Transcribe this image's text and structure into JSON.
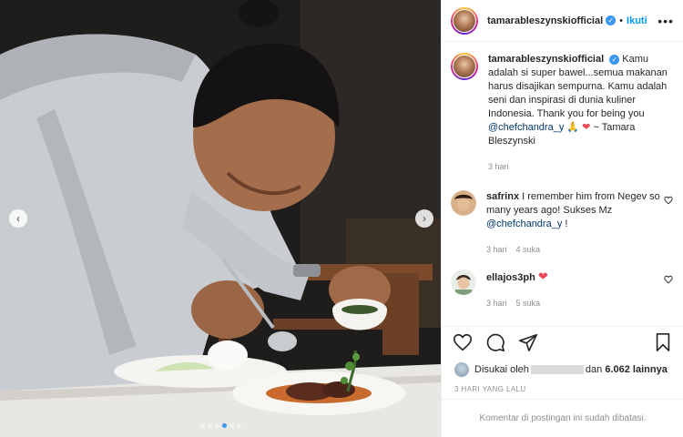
{
  "post": {
    "username": "tamarableszynskiofficial",
    "separator": "•",
    "follow_label": "Ikuti",
    "more_label": "•••"
  },
  "caption": {
    "username": "tamarableszynskiofficial",
    "text_before": "Kamu adalah si super bawel...semua makanan harus disajikan sempurna. Kamu adalah seni dan inspirasi di dunia kuliner Indonesia. Thank you for being you",
    "mention": "@chefchandra_y",
    "emoji": "🙏",
    "text_after": "~ Tamara Bleszynski",
    "time": "3 hari"
  },
  "comments": [
    {
      "username": "safrinx",
      "text_before": "I remember him from Negev so many years ago! Sukses Mz",
      "mention": "@chefchandra_y",
      "text_after": "!",
      "time": "3 hari",
      "likes": "4 suka"
    },
    {
      "username": "ellajos3ph",
      "time": "3 hari",
      "likes": "5 suka"
    }
  ],
  "likes_bar": {
    "prefix": "Disukai oleh",
    "connector": "dan",
    "count": "6.062 lainnya"
  },
  "date": "3 HARI YANG LALU",
  "comments_closed": "Komentar di postingan ini sudah dibatasi.",
  "carousel": {
    "slides": 6,
    "active_index": 3
  },
  "colors": {
    "accent": "#0095f6",
    "verified": "#3897f0",
    "heart": "#ed4956",
    "muted": "#8e8e8e"
  },
  "icons": {
    "prev": "chevron-left-icon",
    "next": "chevron-right-icon",
    "like": "heart-icon",
    "comment": "comment-icon",
    "share": "share-icon",
    "save": "bookmark-icon"
  }
}
